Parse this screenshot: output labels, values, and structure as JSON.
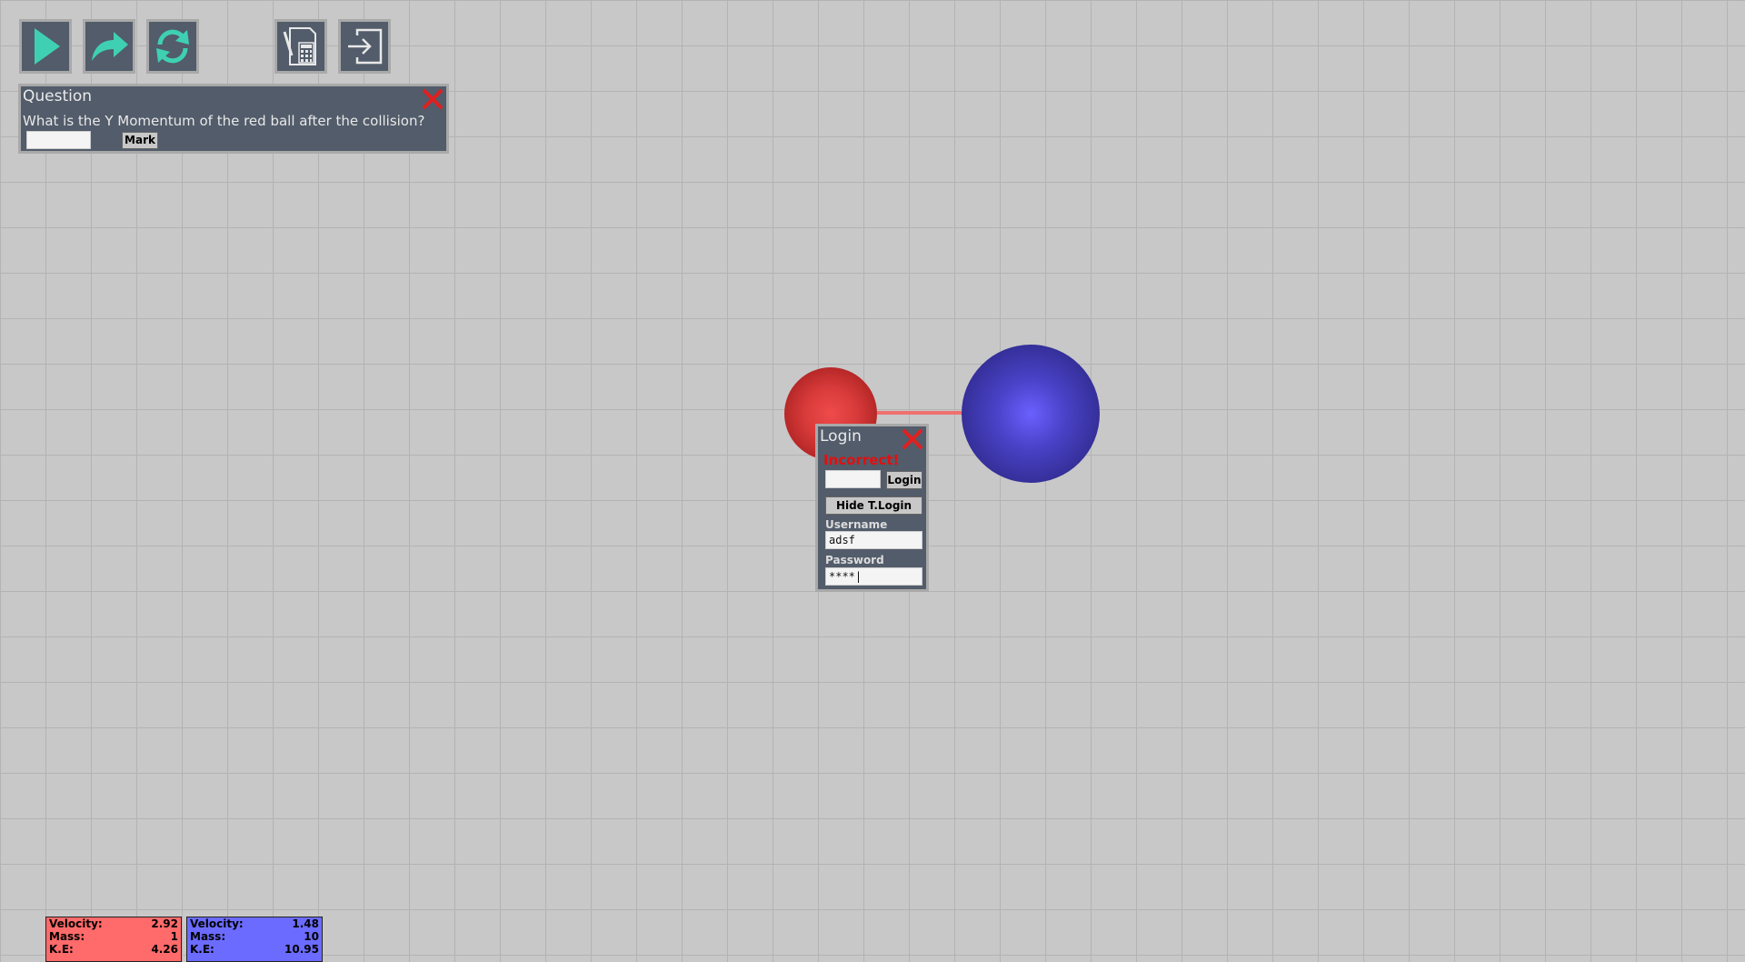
{
  "toolbar": {
    "buttons": [
      {
        "name": "play",
        "icon": "play-icon"
      },
      {
        "name": "step",
        "icon": "forward-arrow-icon"
      },
      {
        "name": "reset",
        "icon": "refresh-icon"
      },
      {
        "name": "calculator",
        "icon": "notepad-calculator-icon"
      },
      {
        "name": "login",
        "icon": "login-arrow-icon"
      }
    ],
    "accent_color": "#3fd0b4"
  },
  "question_panel": {
    "title": "Question",
    "question": "What is the Y Momentum of the red ball after the collision?",
    "answer_value": "",
    "mark_label": "Mark"
  },
  "login_panel": {
    "title": "Login",
    "status": "Incorrect!",
    "code_value": "",
    "login_label": "Login",
    "hide_label": "Hide T.Login",
    "username_label": "Username",
    "username_value": "adsf",
    "password_label": "Password",
    "password_value": "****|"
  },
  "red_ball": {
    "color": "#d83a3a",
    "velocity_label": "Velocity:",
    "velocity": "2.92",
    "mass_label": "Mass:",
    "mass": "1",
    "ke_label": "K.E:",
    "ke": "4.26"
  },
  "blue_ball": {
    "color": "#4a42c8",
    "velocity_label": "Velocity:",
    "velocity": "1.48",
    "mass_label": "Mass:",
    "mass": "10",
    "ke_label": "K.E:",
    "ke": "10.95"
  }
}
